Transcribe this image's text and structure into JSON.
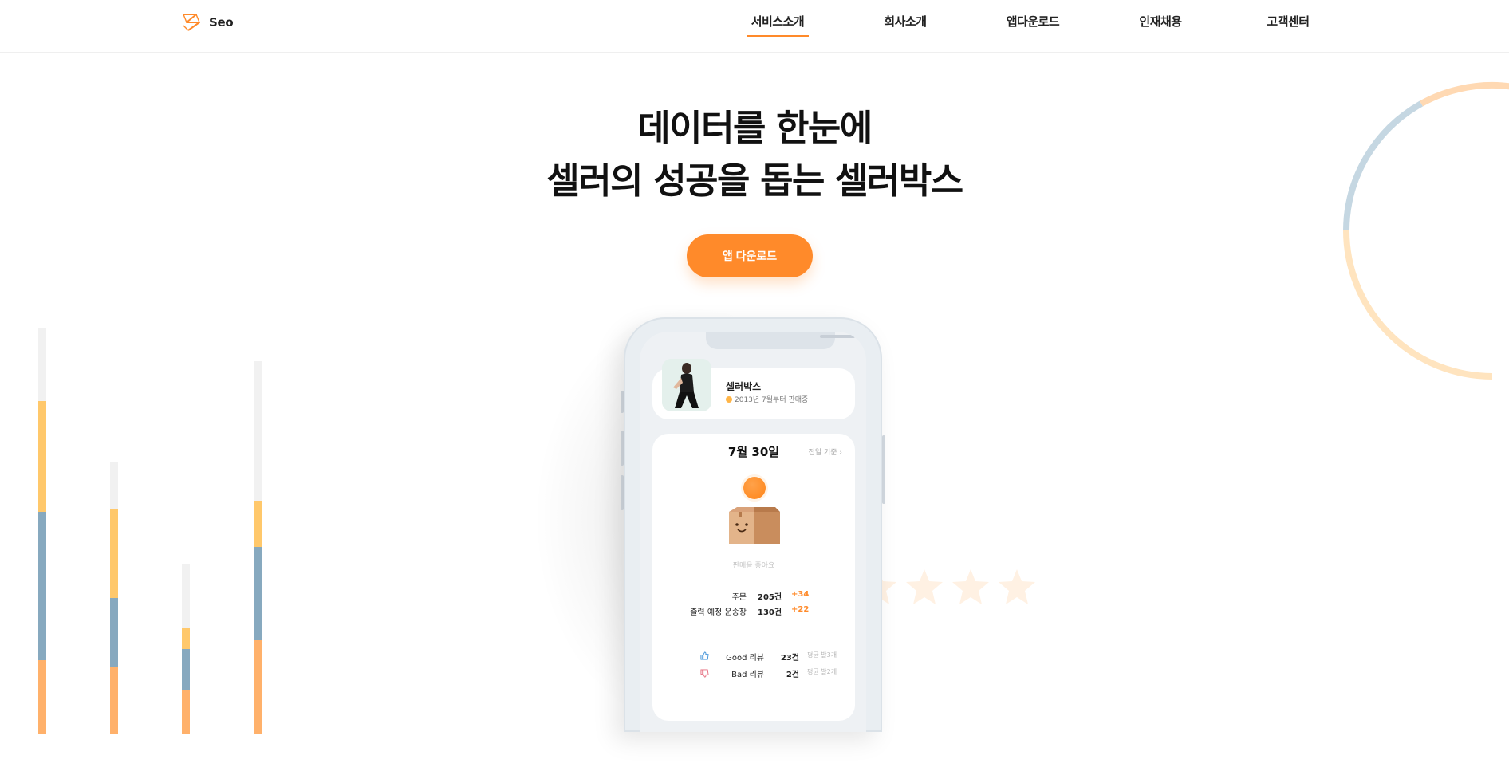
{
  "header": {
    "logo_text": "Seo",
    "nav": [
      "서비스소개",
      "회사소개",
      "앱다운로드",
      "인재채용",
      "고객센터"
    ],
    "active_nav": "서비스소개"
  },
  "hero": {
    "title_line1": "데이터를 한눈에",
    "title_line2": "셀러의 성공을 돕는 셀러박스",
    "cta_label": "앱 다운로드"
  },
  "phone": {
    "profile": {
      "name": "셀러박스",
      "since": "2013년 7월부터 판매중"
    },
    "date": "7월 30일",
    "date_ref": "전일 기준",
    "status": "판매을 좋아요",
    "stats": [
      {
        "label": "주문",
        "value": "205건",
        "delta": "+34"
      },
      {
        "label": "출력 예정 운송장",
        "value": "130건",
        "delta": "+22"
      }
    ],
    "reviews": [
      {
        "label": "Good 리뷰",
        "value": "23건",
        "avg": "평균 발3개",
        "icon": "thumbs-up-icon"
      },
      {
        "label": "Bad 리뷰",
        "value": "2건",
        "avg": "평균 발2개",
        "icon": "thumbs-down-icon"
      }
    ]
  },
  "colors": {
    "accent": "#ff8a2a",
    "bar_orange": "#ffb16b",
    "bar_blue": "#87a9bf",
    "bar_yellow": "#ffc86b",
    "bar_grey": "#f1f1f1"
  }
}
